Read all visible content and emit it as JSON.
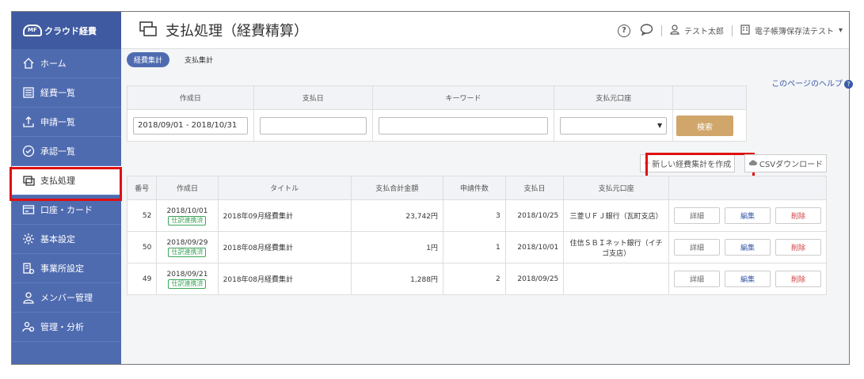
{
  "app": {
    "brand_name": "クラウド経費",
    "brand_logo_text": "MF"
  },
  "sidebar": {
    "items": [
      {
        "label": "ホーム",
        "icon": "home-icon"
      },
      {
        "label": "経費一覧",
        "icon": "list-icon"
      },
      {
        "label": "申請一覧",
        "icon": "upload-icon"
      },
      {
        "label": "承認一覧",
        "icon": "check-circle-icon"
      },
      {
        "label": "支払処理",
        "icon": "payment-icon"
      },
      {
        "label": "口座・カード",
        "icon": "card-icon"
      },
      {
        "label": "基本設定",
        "icon": "gear-icon"
      },
      {
        "label": "事業所設定",
        "icon": "office-gear-icon"
      },
      {
        "label": "メンバー管理",
        "icon": "user-icon"
      },
      {
        "label": "管理・分析",
        "icon": "analysis-icon"
      }
    ]
  },
  "header": {
    "title": "支払処理（経費精算）",
    "user_name": "テスト太郎",
    "office_name": "電子帳簿保存法テスト",
    "dropdown_caret": "▾"
  },
  "tabs": {
    "expense_summary": "経費集計",
    "payment_summary": "支払集計"
  },
  "help": {
    "label": "このページのヘルプ",
    "icon_glyph": "?"
  },
  "search": {
    "headers": [
      "作成日",
      "支払日",
      "キーワード",
      "支払元口座"
    ],
    "created_date_value": "2018/09/01 - 2018/10/31",
    "payment_date_value": "",
    "keyword_value": "",
    "account_value": "",
    "select_caret": "▼",
    "button": "検索"
  },
  "actions": {
    "new_label": "新しい経費集計を作成",
    "new_plus": "+",
    "csv_label": "CSVダウンロード"
  },
  "table": {
    "headers": [
      "番号",
      "作成日",
      "タイトル",
      "支払合計金額",
      "申請件数",
      "支払日",
      "支払元口座",
      ""
    ],
    "linked_badge": "仕訳連携済",
    "buttons": {
      "detail": "詳細",
      "edit": "編集",
      "delete": "削除"
    },
    "rows": [
      {
        "no": "52",
        "created": "2018/10/01",
        "title": "2018年09月経費集計",
        "amount": "23,742円",
        "count": "3",
        "paid": "2018/10/25",
        "account": "三菱ＵＦＪ銀行（瓦町支店）"
      },
      {
        "no": "50",
        "created": "2018/09/29",
        "title": "2018年08月経費集計",
        "amount": "1円",
        "count": "1",
        "paid": "2018/10/01",
        "account": "住信ＳＢＩネット銀行（イチゴ支店）"
      },
      {
        "no": "49",
        "created": "2018/09/21",
        "title": "2018年08月経費集計",
        "amount": "1,288円",
        "count": "2",
        "paid": "2018/09/25",
        "account": ""
      }
    ]
  },
  "colors": {
    "sidebar_bg": "#4f6bb0",
    "highlight": "#e01010",
    "search_button": "#d0a66a",
    "badge": "#3da55a"
  }
}
